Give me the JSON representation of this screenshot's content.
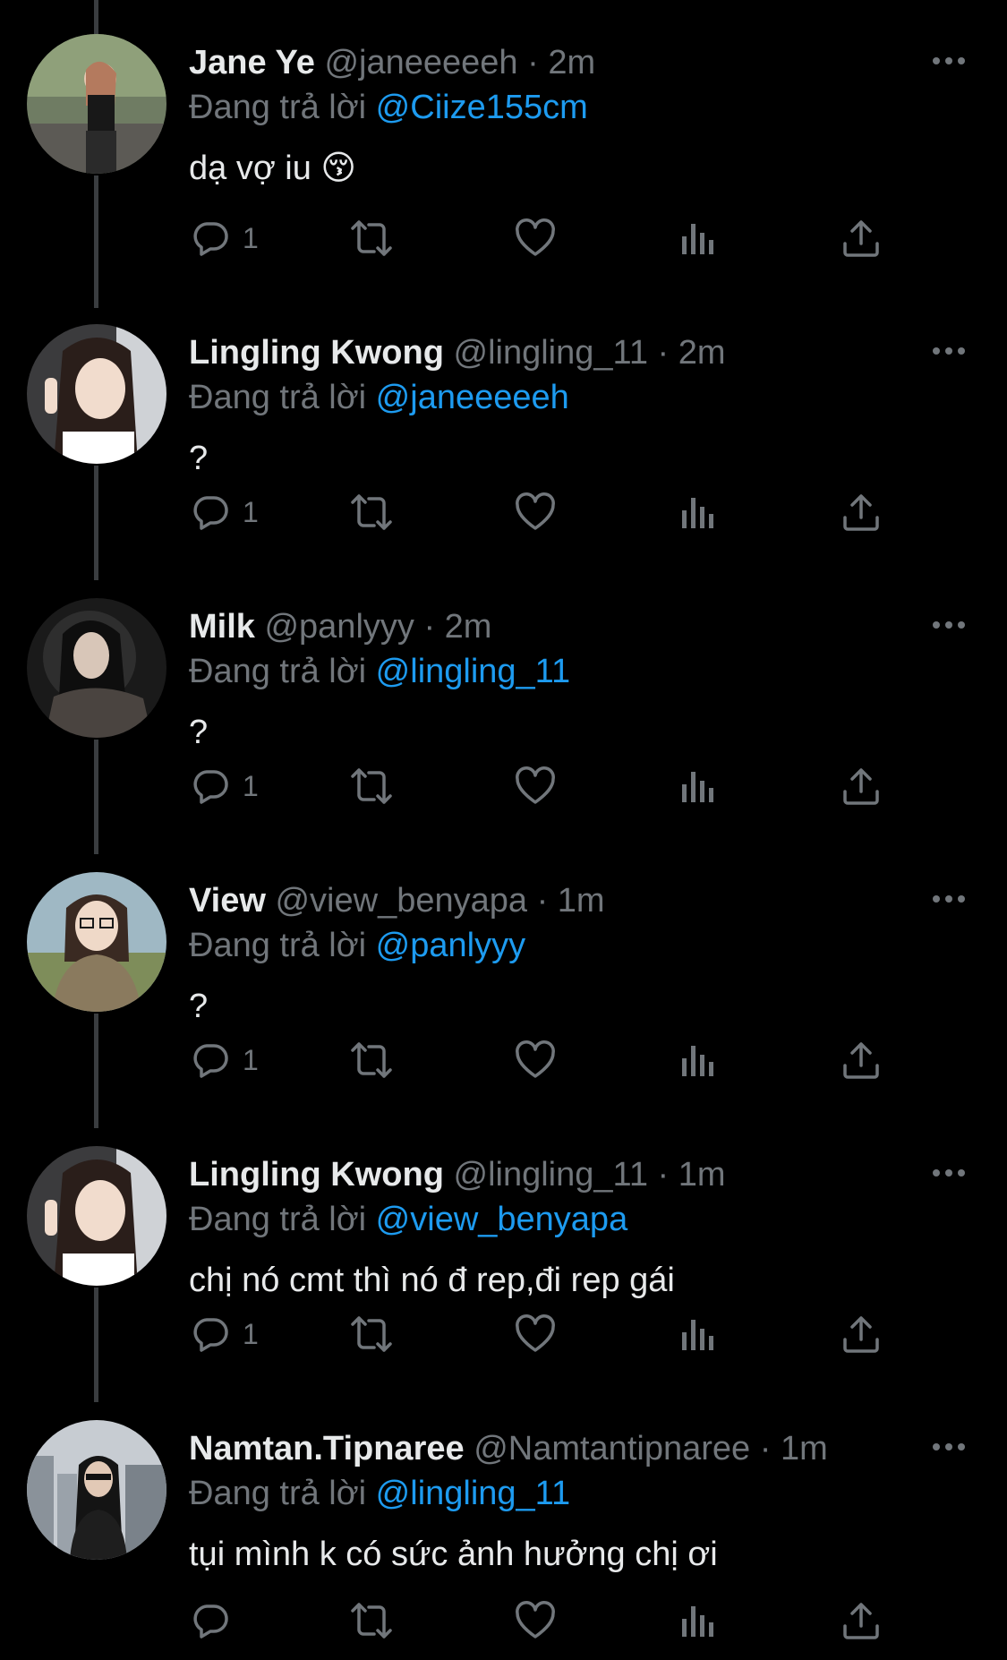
{
  "replying_prefix": "Đang trả lời",
  "tweets": [
    {
      "name": "Jane Ye",
      "handle": "@janeeeeeh",
      "time": "2m",
      "replying_to": "@Ciize155cm",
      "text": "dạ vợ iu 😚",
      "reply_count": "1"
    },
    {
      "name": "Lingling Kwong",
      "handle": "@lingling_11",
      "time": "2m",
      "replying_to": "@janeeeeeh",
      "text": "?",
      "reply_count": "1"
    },
    {
      "name": "Milk",
      "handle": "@panlyyy",
      "time": "2m",
      "replying_to": "@lingling_11",
      "text": "?",
      "reply_count": "1"
    },
    {
      "name": "View",
      "handle": "@view_benyapa",
      "time": "1m",
      "replying_to": "@panlyyy",
      "text": "?",
      "reply_count": "1"
    },
    {
      "name": "Lingling Kwong",
      "handle": "@lingling_11",
      "time": "1m",
      "replying_to": "@view_benyapa",
      "text": "chị nó cmt thì nó đ rep,đi rep gái",
      "reply_count": "1"
    },
    {
      "name": "Namtan.Tipnaree",
      "handle": "@Namtantipnaree",
      "time": "1m",
      "replying_to": "@lingling_11",
      "text": "tụi mình k có sức ảnh hưởng chị ơi",
      "reply_count": ""
    }
  ],
  "icons": {
    "reply": "reply-icon",
    "retweet": "retweet-icon",
    "like": "heart-icon",
    "views": "views-icon",
    "share": "share-icon",
    "more": "more-icon"
  },
  "colors": {
    "background": "#000000",
    "text": "#e7e9ea",
    "secondary": "#71767b",
    "link": "#1d9bf0",
    "thread_line": "#3a3d40"
  }
}
